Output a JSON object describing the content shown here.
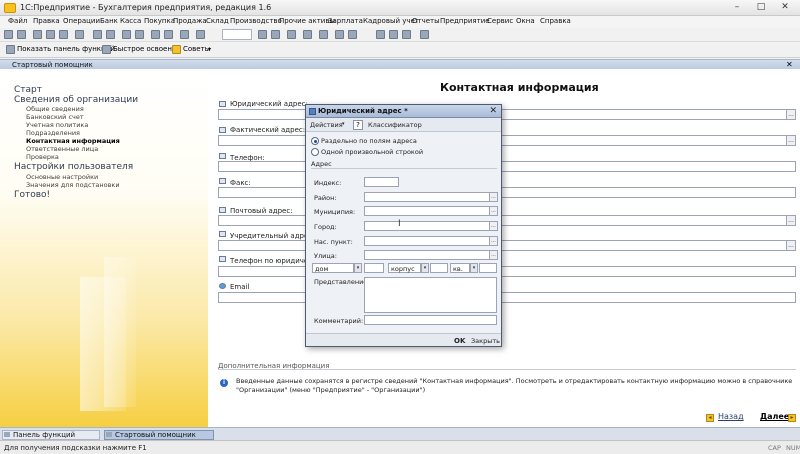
{
  "window": {
    "title": "1С:Предприятие - Бухгалтерия предприятия, редакция 1.6"
  },
  "menu": [
    "Файл",
    "Правка",
    "Операции",
    "Банк",
    "Касса",
    "Покупка",
    "Продажа",
    "Склад",
    "Производство",
    "Прочие активы",
    "Зарплата",
    "Кадровый учет",
    "Отчеты",
    "Предприятие",
    "Сервис",
    "Окна",
    "Справка"
  ],
  "toolbar2": {
    "show_panel": "Показать панель функций",
    "quick_start": "Быстрое освоение",
    "tips": "Советы"
  },
  "document_tab": "Стартовый помощник",
  "nav": {
    "start": "Старт",
    "org_info": "Сведения об организации",
    "org_items": [
      "Общие сведения",
      "Банковский счет",
      "Учетная политика",
      "Подразделения",
      "Контактная информация",
      "Ответственные лица",
      "Проверка"
    ],
    "user_settings": "Настройки пользователя",
    "user_items": [
      "Основные настройки",
      "Значения для подстановки"
    ],
    "ready": "Готово!"
  },
  "form": {
    "title": "Контактная информация",
    "fields": [
      "Юридический адрес:",
      "Фактический адрес:",
      "Телефон:",
      "Факс:",
      "Почтовый адрес:",
      "Учредительный адрес и",
      "Телефон по юридическо",
      "Email"
    ],
    "extra_title": "Дополнительная информация",
    "info": "Введенные данные сохранятся в регистре сведений \"Контактная информация\". Посмотреть и отредактировать контактную информацию можно в справочнике \"Организации\" (меню \"Предприятие\" - \"Организации\")",
    "back": "Назад",
    "next": "Далее"
  },
  "modal": {
    "title": "Юридический адрес *",
    "actions": "Действия",
    "help": "?",
    "classifier": "Классификатор",
    "radio_fields": "Раздельно по полям адреса",
    "radio_string": "Одной произвольной строкой",
    "address_label": "Адрес",
    "index": "Индекс:",
    "district": "Район:",
    "municipality": "Муниципия:",
    "city": "Город:",
    "settlement": "Нас. пункт:",
    "street": "Улица:",
    "house_type": "дом",
    "building_type": "корпус",
    "flat_type": "кв.",
    "presentation": "Представление:",
    "comment": "Комментарий:",
    "ok": "OK",
    "close": "Закрыть"
  },
  "taskbar": {
    "functions_panel": "Панель функций",
    "start_assistant": "Стартовый помощник"
  },
  "status": {
    "hint": "Для получения подсказки нажмите F1",
    "cap": "CAP",
    "num": "NUM"
  }
}
